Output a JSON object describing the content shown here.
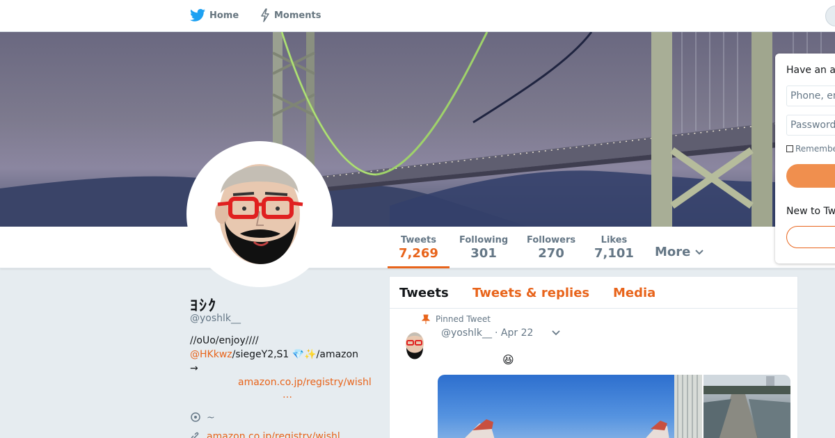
{
  "nav": {
    "home_label": "Home",
    "moments_label": "Moments"
  },
  "profile": {
    "name": "ﾖｼｸ",
    "handle": "@yoshlk__",
    "bio_line1": "//oUo/enjoy////",
    "bio_mention": "@HKkwz",
    "bio_line2_rest": "/siegeY2,S1  💎✨/amazon",
    "bio_arrow": "→",
    "bio_url": "amazon.co.jp/registry/wishl",
    "bio_ellipsis": "…",
    "location": "~",
    "website": "amazon.co.jp/registry/wishl"
  },
  "stats": [
    {
      "label": "Tweets",
      "value": "7,269"
    },
    {
      "label": "Following",
      "value": "301"
    },
    {
      "label": "Followers",
      "value": "270"
    },
    {
      "label": "Likes",
      "value": "7,101"
    }
  ],
  "more_label": "More",
  "tabs": [
    {
      "label": "Tweets"
    },
    {
      "label": "Tweets & replies"
    },
    {
      "label": "Media"
    }
  ],
  "tweet": {
    "pinned_label": "Pinned Tweet",
    "handle": "@yoshlk__",
    "date": "· Apr 22",
    "emoji": "😆"
  },
  "login": {
    "title": "Have an a",
    "phone_placeholder": "Phone, em",
    "password_placeholder": "Password",
    "remember_label": "Remembe",
    "new_to": "New to Tw"
  },
  "colors": {
    "accent": "#e8641b",
    "background": "#e6ecf0",
    "twitter_blue": "#1da1f2"
  }
}
